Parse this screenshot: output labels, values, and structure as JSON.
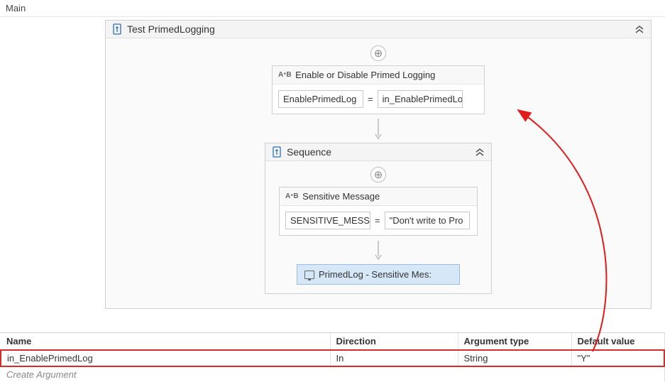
{
  "breadcrumb": "Main",
  "outer": {
    "title": "Test PrimedLogging"
  },
  "assign1": {
    "title": "Enable or Disable Primed Logging",
    "lhs": "EnablePrimedLog",
    "rhs": "in_EnablePrimedLo"
  },
  "sequence": {
    "title": "Sequence"
  },
  "assign2": {
    "title": "Sensitive Message",
    "lhs": "SENSITIVE_MESSA(",
    "rhs": "\"Don't write to Pro"
  },
  "primedLog": {
    "label": "PrimedLog - Sensitive Mes:"
  },
  "args": {
    "headers": {
      "name": "Name",
      "direction": "Direction",
      "argtype": "Argument type",
      "default": "Default value"
    },
    "row": {
      "name": "in_EnablePrimedLog",
      "direction": "In",
      "argtype": "String",
      "default": "\"Y\""
    },
    "create": "Create Argument"
  }
}
